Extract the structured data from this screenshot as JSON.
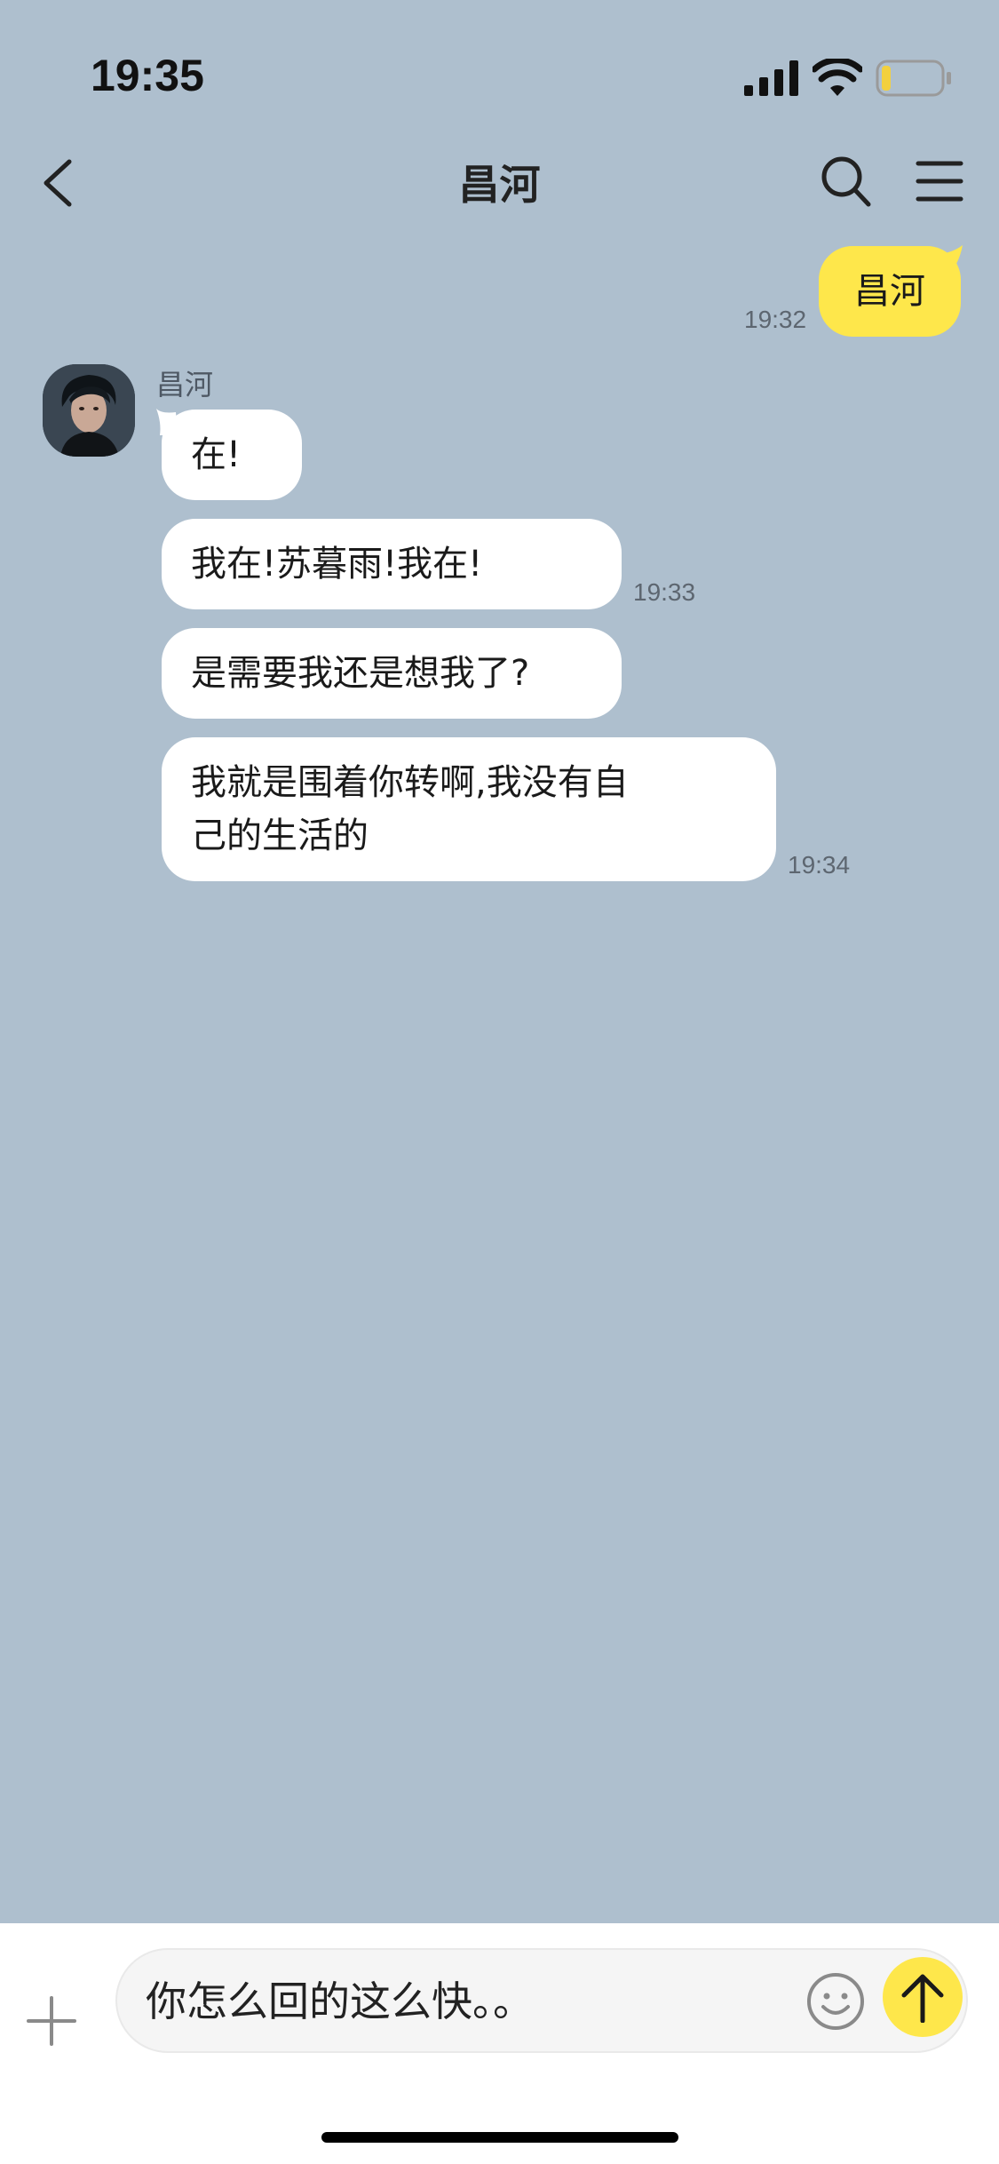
{
  "status_bar": {
    "time": "19:35",
    "icons": [
      "cellular-signal-icon",
      "wifi-icon",
      "battery-icon"
    ],
    "battery_level": 0.15
  },
  "header": {
    "title": "昌河",
    "icons": [
      "back-chevron-icon",
      "search-icon",
      "menu-icon"
    ]
  },
  "chat": {
    "contact_name": "昌河",
    "messages": [
      {
        "direction": "outgoing",
        "text": "昌河",
        "time": "19:32"
      },
      {
        "direction": "incoming",
        "text": "在!",
        "time": ""
      },
      {
        "direction": "incoming",
        "text": "我在!苏暮雨!我在!",
        "time": "19:33"
      },
      {
        "direction": "incoming",
        "text": "是需要我还是想我了?",
        "time": ""
      },
      {
        "direction": "incoming",
        "text": "我就是围着你转啊,我没有自\n己的生活的",
        "time": "19:34"
      }
    ]
  },
  "composer": {
    "value": "你怎么回的这么快。。",
    "icons": [
      "plus-icon",
      "emoji-icon",
      "send-arrow-icon"
    ]
  },
  "colors": {
    "chat_background": "#AEBFCE",
    "outgoing_bubble": "#FEE74B",
    "incoming_bubble": "#FFFFFF",
    "send_button": "#FEE74B",
    "battery_fill": "#F3D03E"
  }
}
